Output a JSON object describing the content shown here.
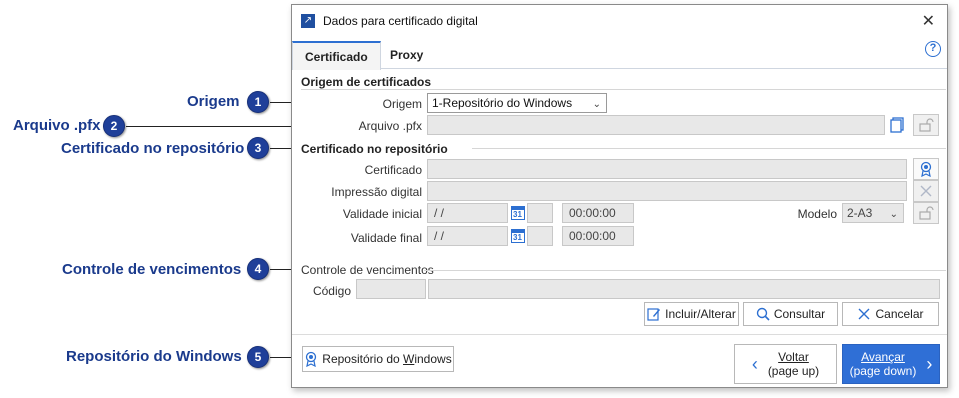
{
  "callouts": [
    {
      "num": "1",
      "label": "Origem"
    },
    {
      "num": "2",
      "label": "Arquivo .pfx"
    },
    {
      "num": "3",
      "label": "Certificado no repositório"
    },
    {
      "num": "4",
      "label": "Controle de vencimentos"
    },
    {
      "num": "5",
      "label": "Repositório do Windows"
    }
  ],
  "dialog": {
    "title": "Dados para certificado digital",
    "tabs": [
      "Certificado",
      "Proxy"
    ],
    "help_icon": "?",
    "origem_section": "Origem de certificados",
    "origem_label": "Origem",
    "origem_value": "1-Repositório do Windows",
    "arquivo_label": "Arquivo .pfx",
    "repo_section": "Certificado no repositório",
    "certificado_label": "Certificado",
    "impressao_label": "Impressão digital",
    "validade_inicial_label": "Validade inicial",
    "validade_inicial_date": "/ /",
    "validade_inicial_time": "00:00:00",
    "validade_final_label": "Validade final",
    "validade_final_date": "/ /",
    "validade_final_time": "00:00:00",
    "modelo_label": "Modelo",
    "modelo_value": "2-A3",
    "vencimentos_section": "Controle de vencimentos",
    "codigo_label": "Código",
    "incluir_btn": "Incluir/Alterar",
    "consultar_btn": "Consultar",
    "cancelar_btn": "Cancelar",
    "repo_windows_btn_pre": "Repositório do ",
    "repo_windows_btn_u": "W",
    "repo_windows_btn_post": "indows",
    "voltar_line1": "Voltar",
    "voltar_line2": "(page up)",
    "avancar_line1": "Avançar",
    "avancar_line2": "(page down)"
  },
  "colors": {
    "accent": "#2c6fd1",
    "primary_button": "#2f6fd6",
    "callout": "#1f3f99"
  }
}
